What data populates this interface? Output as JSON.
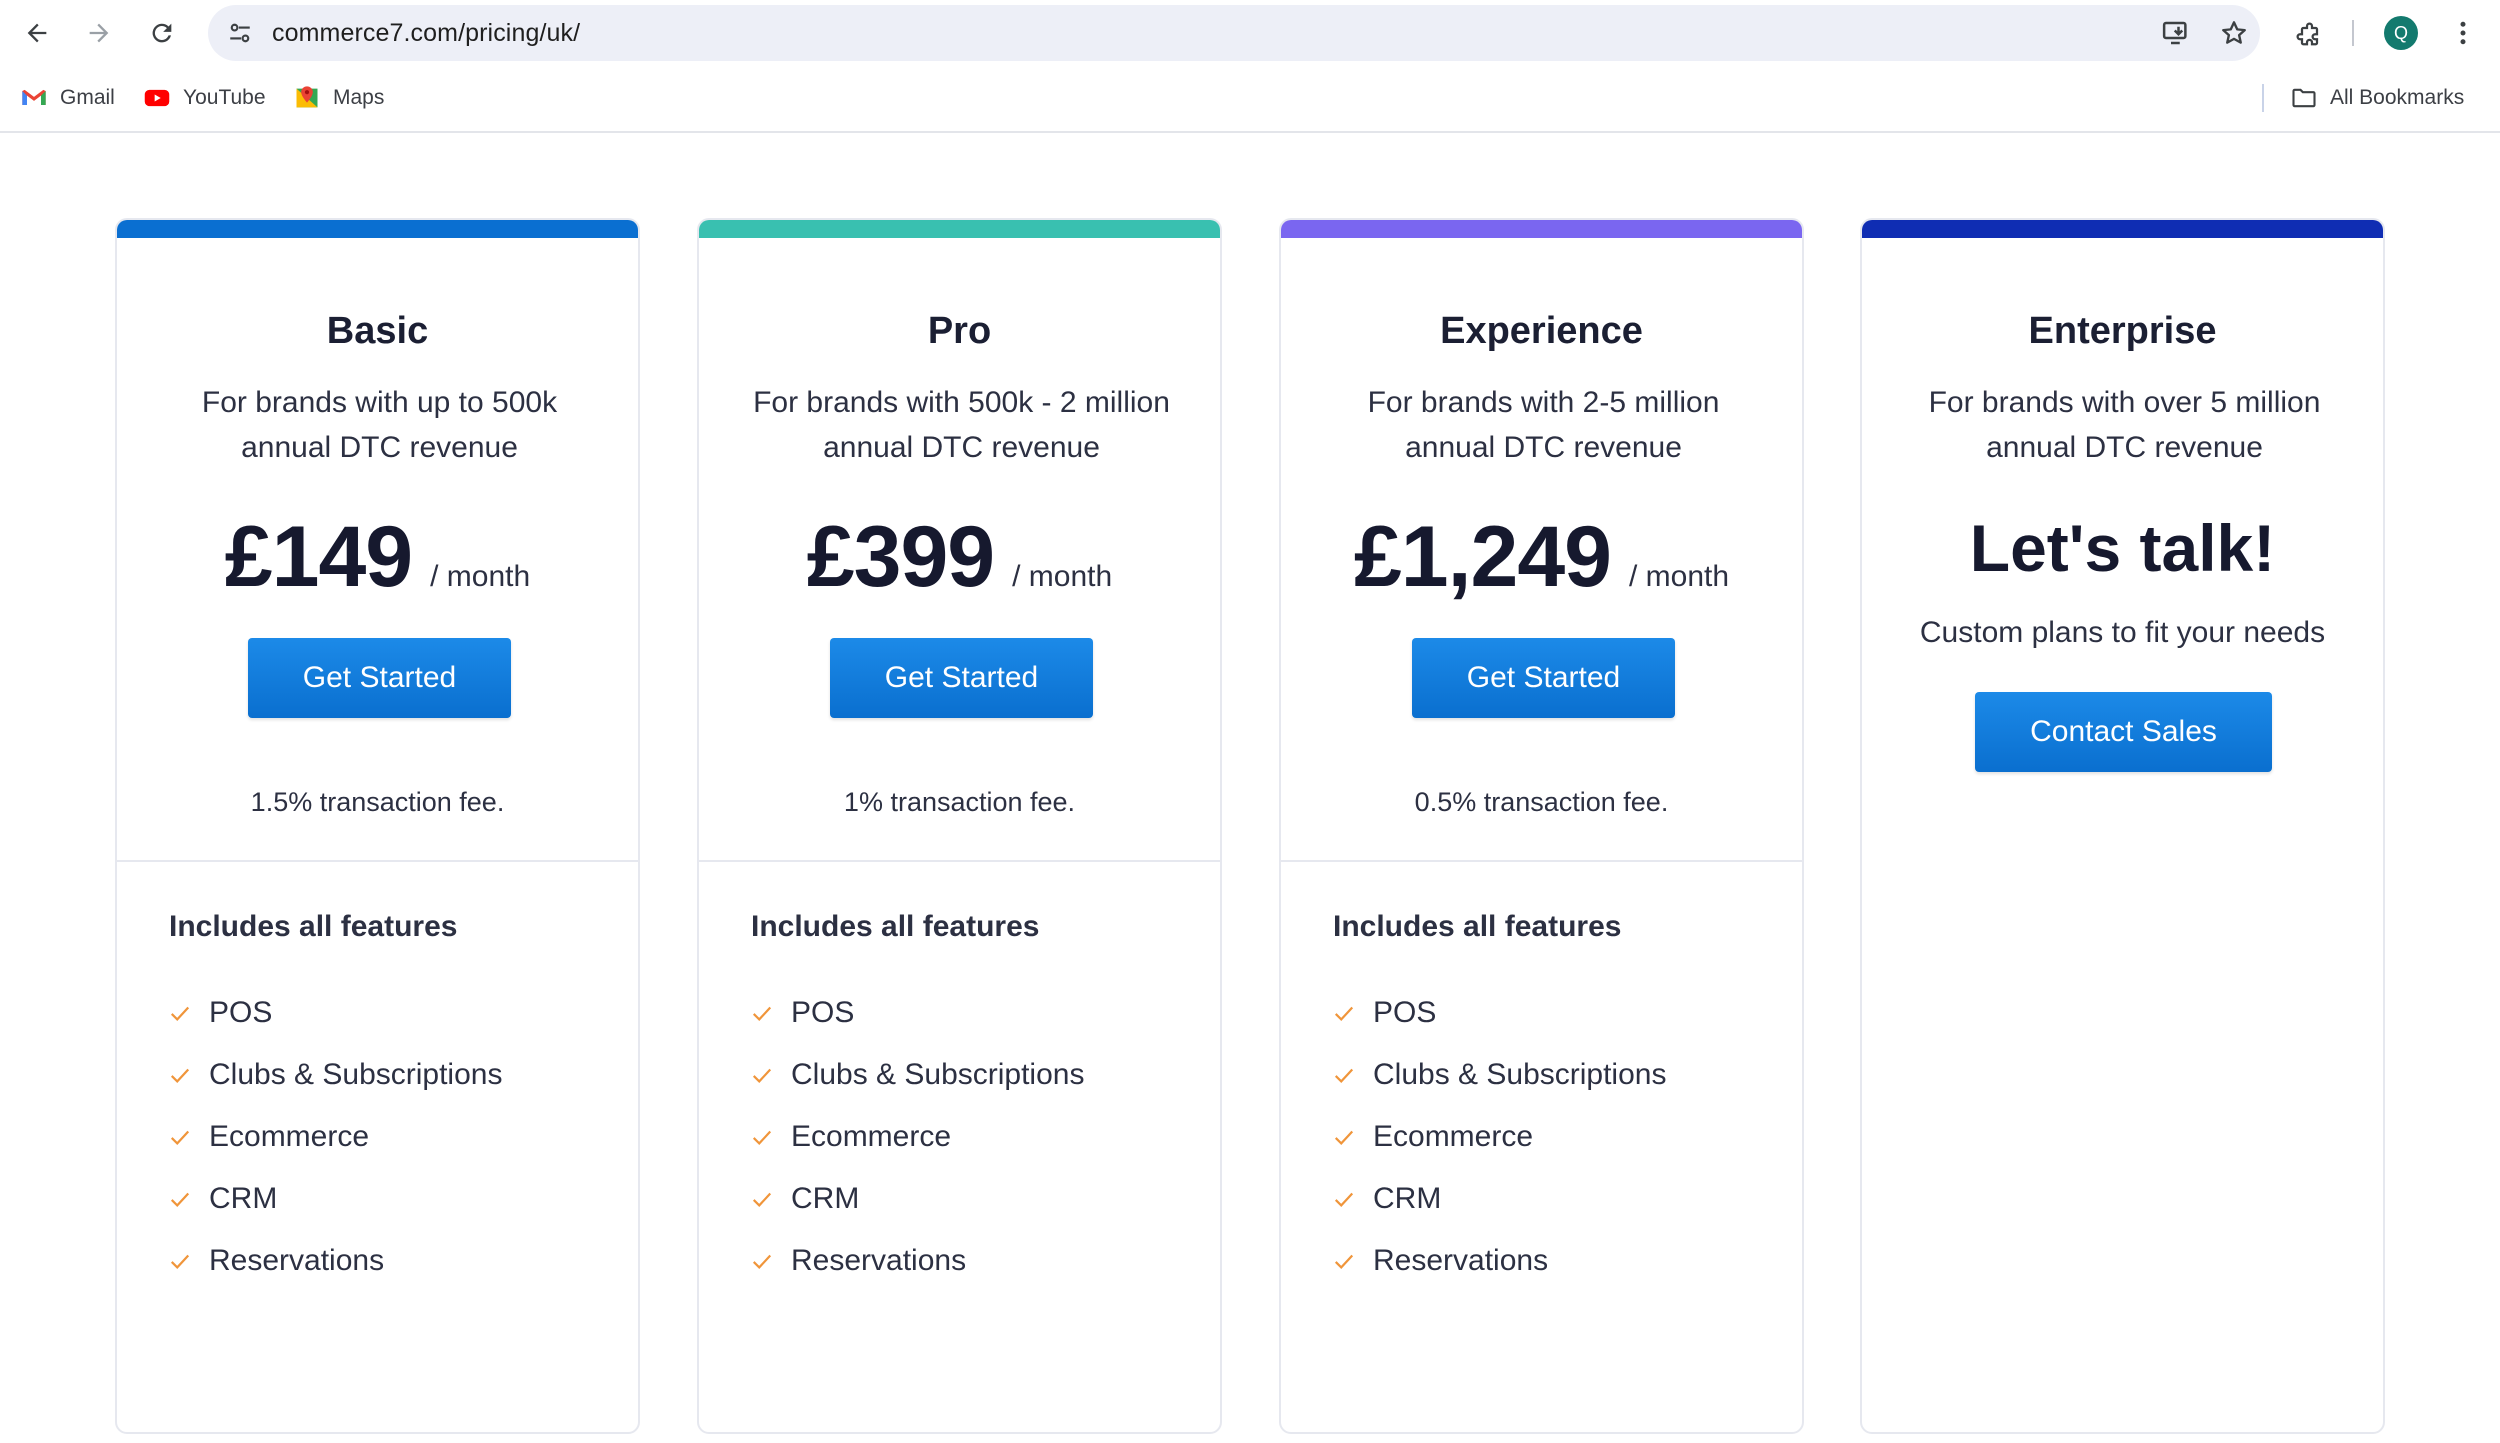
{
  "browser": {
    "url": "commerce7.com/pricing/uk/",
    "avatar_letter": "Q",
    "bookmarks": [
      {
        "label": "Gmail",
        "icon": "gmail-icon"
      },
      {
        "label": "YouTube",
        "icon": "youtube-icon"
      },
      {
        "label": "Maps",
        "icon": "maps-icon"
      }
    ],
    "all_bookmarks": "All Bookmarks"
  },
  "plans": [
    {
      "name": "Basic",
      "desc": "For brands with up to 500k annual DTC revenue",
      "price": "£149",
      "period": "/ month",
      "cta": "Get Started",
      "fee": "1.5% transaction fee.",
      "accent": "#0a6fd1",
      "features_title": "Includes all features",
      "features": [
        "POS",
        "Clubs & Subscriptions",
        "Ecommerce",
        "CRM",
        "Reservations"
      ]
    },
    {
      "name": "Pro",
      "desc": "For brands with 500k - 2 million annual DTC revenue",
      "price": "£399",
      "period": "/ month",
      "cta": "Get Started",
      "fee": "1% transaction fee.",
      "accent": "#39c0b0",
      "features_title": "Includes all features",
      "features": [
        "POS",
        "Clubs & Subscriptions",
        "Ecommerce",
        "CRM",
        "Reservations"
      ]
    },
    {
      "name": "Experience",
      "desc": "For brands with 2-5 million annual DTC revenue",
      "price": "£1,249",
      "period": "/ month",
      "cta": "Get Started",
      "fee": "0.5% transaction fee.",
      "accent": "#7a66f0",
      "features_title": "Includes all features",
      "features": [
        "POS",
        "Clubs & Subscriptions",
        "Ecommerce",
        "CRM",
        "Reservations"
      ]
    },
    {
      "name": "Enterprise",
      "desc": "For brands with over 5 million annual DTC revenue",
      "headline": "Let's talk!",
      "subtext": "Custom plans to fit your needs",
      "cta": "Contact Sales",
      "accent": "#0f2db3"
    }
  ],
  "colors": {
    "button": "#1382e0",
    "check": "#f0953a",
    "text": "#2c3042"
  }
}
